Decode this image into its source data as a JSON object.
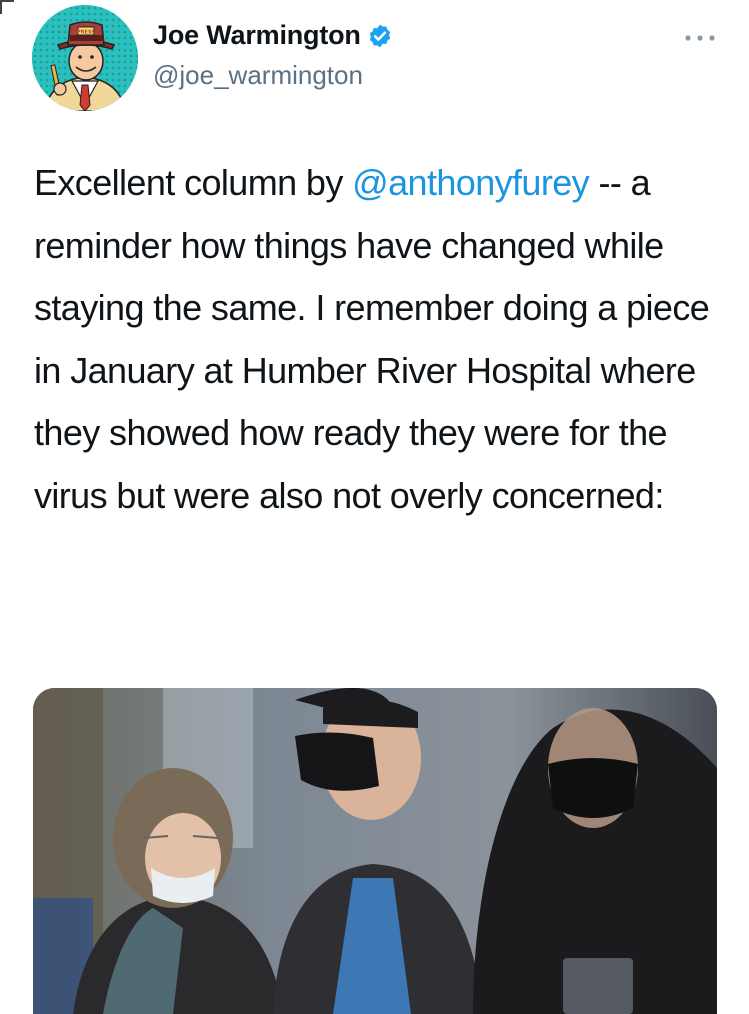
{
  "tweet": {
    "author": {
      "display_name": "Joe Warmington",
      "handle": "@joe_warmington",
      "verified": true,
      "avatar_badge": "PRESS"
    },
    "more_options_icon": "ellipsis-icon",
    "text": {
      "before": "Excellent column by ",
      "mention": "@anthonyfurey",
      "after": " -- a reminder how things have changed while staying the same. I remember doing a piece in January at Humber River Hospital where they showed how ready they were for the virus but were also not overly concerned:"
    },
    "media": {
      "kind": "photo"
    }
  },
  "colors": {
    "mention": "#1b95e0",
    "verified_badge": "#1da1f2",
    "secondary_text": "#5b7083",
    "avatar_bg": "#27b6b4"
  }
}
